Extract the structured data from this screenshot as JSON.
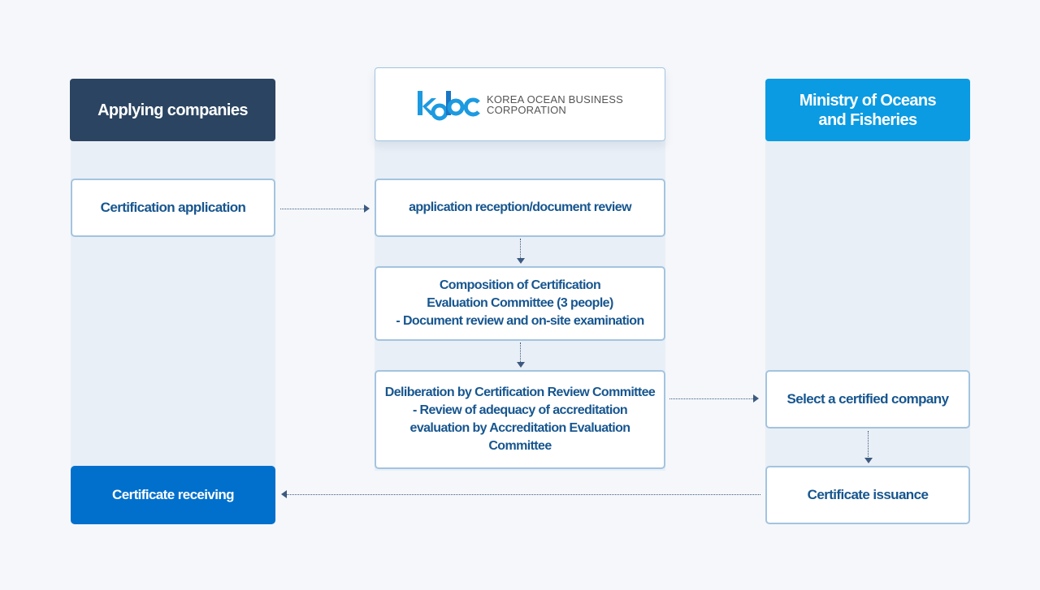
{
  "colors": {
    "lane_bg": "#e9eff6",
    "applicant_header": "#2b4461",
    "ministry_header": "#0a9be3",
    "final_box": "#0070cc",
    "box_text": "#17568f",
    "box_border": "#a3c4e0",
    "logo_blue": "#1d9ae0"
  },
  "columns": {
    "applicant": {
      "title": "Applying companies"
    },
    "kobc": {
      "logo_mark": "kobc",
      "logo_line1": "KOREA OCEAN BUSINESS",
      "logo_line2": "CORPORATION"
    },
    "ministry": {
      "title": "Ministry of Oceans\nand Fisheries"
    }
  },
  "steps": {
    "certification_application": "Certification application",
    "reception_review": "application reception/document review",
    "committee_composition": "Composition of Certification\nEvaluation Committee (3 people)\n- Document review and on-site examination",
    "deliberation": "Deliberation by Certification Review Committee\n- Review of adequacy of accreditation\nevaluation by  Accreditation Evaluation\nCommittee",
    "select_company": "Select a certified company",
    "certificate_issuance": "Certificate issuance",
    "certificate_receiving": "Certificate receiving"
  }
}
